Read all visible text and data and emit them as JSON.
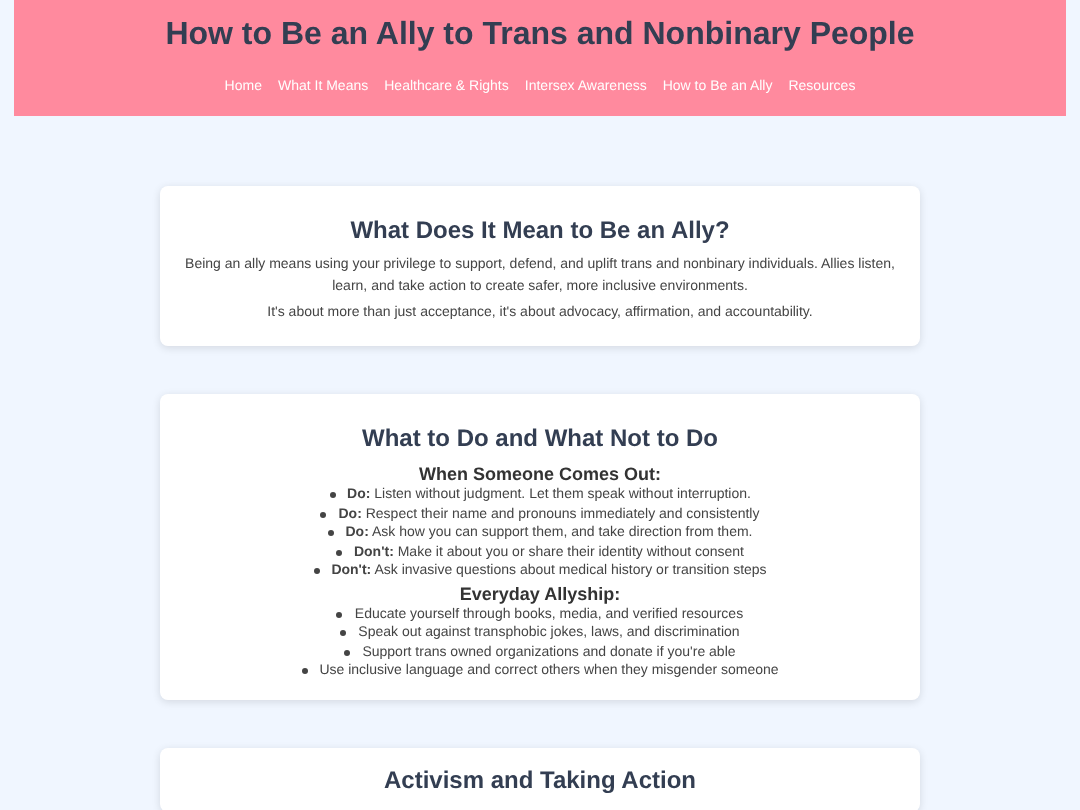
{
  "header": {
    "title": "How to Be an Ally to Trans and Nonbinary People",
    "nav": [
      "Home",
      "What It Means",
      "Healthcare & Rights",
      "Intersex Awareness",
      "How to Be an Ally",
      "Resources"
    ]
  },
  "sections": [
    {
      "title": "What Does It Mean to Be an Ally?",
      "blocks": [
        {
          "kind": "paragraph",
          "text": "Being an ally means using your privilege to support, defend, and uplift trans and nonbinary individuals. Allies listen, learn, and take action to create safer, more inclusive environments."
        },
        {
          "kind": "paragraph",
          "text": "It's about more than just acceptance, it's about advocacy, affirmation, and accountability."
        }
      ]
    },
    {
      "title": "What to Do and What Not to Do",
      "blocks": [
        {
          "kind": "heading",
          "text": "When Someone Comes Out:"
        },
        {
          "kind": "list",
          "items": [
            "**Do:** Listen without judgment. Let them speak without interruption.",
            "**Do:** Respect their name and pronouns immediately and consistently",
            "**Do:** Ask how you can support them, and take direction from them.",
            "**Don't:** Make it about you or share their identity without consent",
            "**Don't:** Ask invasive questions about medical history or transition steps"
          ]
        },
        {
          "kind": "heading",
          "text": "Everyday Allyship:"
        },
        {
          "kind": "list",
          "items": [
            "Educate yourself through books, media, and verified resources",
            "Speak out against transphobic jokes, laws, and discrimination",
            "Support trans owned organizations and donate if you're able",
            "Use inclusive language and correct others when they misgender someone"
          ]
        }
      ]
    },
    {
      "title": "Activism and Taking Action"
    }
  ]
}
